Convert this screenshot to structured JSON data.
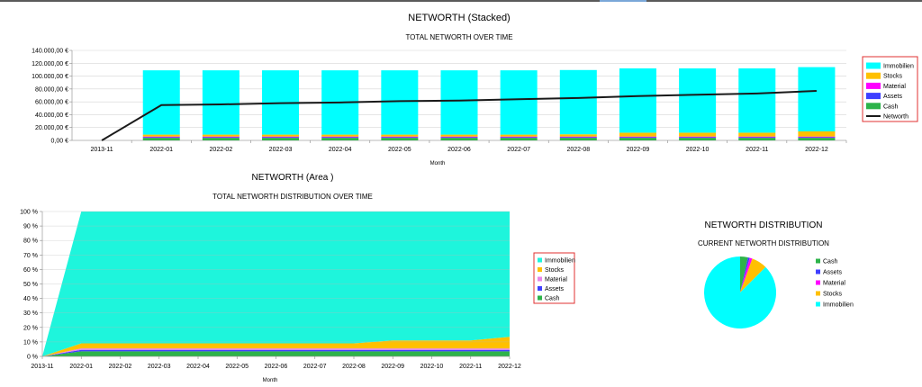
{
  "chart_data": [
    {
      "type": "bar",
      "title": "NETWORTH (Stacked)",
      "subtitle": "TOTAL NETWORTH OVER TIME",
      "xlabel": "Month",
      "ylabel": "",
      "ylim": [
        0,
        140000
      ],
      "yticks": [
        0,
        20000,
        40000,
        60000,
        80000,
        100000,
        120000,
        140000
      ],
      "ytick_labels": [
        "0,00 €",
        "20.000,00 €",
        "40.000,00 €",
        "60.000,00 €",
        "80.000,00 €",
        "100.000,00 €",
        "120.000,00 €",
        "140.000,00 €"
      ],
      "categories": [
        "2013-11",
        "2022-01",
        "2022-02",
        "2022-03",
        "2022-04",
        "2022-05",
        "2022-06",
        "2022-07",
        "2022-08",
        "2022-09",
        "2022-10",
        "2022-11",
        "2022-12"
      ],
      "series": [
        {
          "name": "Immobilien",
          "color": "#00ffff",
          "values": [
            0,
            100000,
            100000,
            100000,
            100000,
            100000,
            100000,
            100000,
            100000,
            100000,
            100000,
            100000,
            100000
          ]
        },
        {
          "name": "Stocks",
          "color": "#ffc000",
          "values": [
            0,
            3000,
            3000,
            3000,
            3000,
            3000,
            3000,
            3000,
            3500,
            6000,
            6000,
            6000,
            8000
          ]
        },
        {
          "name": "Material",
          "color": "#ff00ff",
          "values": [
            0,
            1000,
            1000,
            1000,
            1000,
            1000,
            1000,
            1000,
            1000,
            1000,
            1000,
            1000,
            1000
          ]
        },
        {
          "name": "Assets",
          "color": "#3f3fff",
          "values": [
            0,
            1000,
            1000,
            1000,
            1000,
            1000,
            1000,
            1000,
            1000,
            1000,
            1000,
            1000,
            1000
          ]
        },
        {
          "name": "Cash",
          "color": "#2db34a",
          "values": [
            0,
            4000,
            4000,
            4000,
            4000,
            4000,
            4000,
            4000,
            4000,
            4000,
            4000,
            4000,
            4000
          ]
        }
      ],
      "line": {
        "name": "Networth",
        "color": "#1a1a1a",
        "values": [
          0,
          55000,
          56000,
          58000,
          59000,
          61000,
          62000,
          64000,
          66000,
          69000,
          71000,
          73000,
          77000
        ]
      },
      "legend": {
        "placement": "right",
        "items": [
          "Immobilien",
          "Stocks",
          "Material",
          "Assets",
          "Cash",
          "Networth"
        ],
        "border_color": "#e03030"
      }
    },
    {
      "type": "area",
      "title": "NETWORTH (Area )",
      "subtitle": "TOTAL NETWORTH DISTRIBUTION OVER TIME",
      "xlabel": "Month",
      "ylabel": "",
      "ylim": [
        0,
        100
      ],
      "yticks": [
        0,
        10,
        20,
        30,
        40,
        50,
        60,
        70,
        80,
        90,
        100
      ],
      "ytick_labels": [
        "0 %",
        "10 %",
        "20 %",
        "30 %",
        "40 %",
        "50 %",
        "60 %",
        "70 %",
        "80 %",
        "90 %",
        "100 %"
      ],
      "categories": [
        "2013-11",
        "2022-01",
        "2022-02",
        "2022-03",
        "2022-04",
        "2022-05",
        "2022-06",
        "2022-07",
        "2022-08",
        "2022-09",
        "2022-10",
        "2022-11",
        "2022-12"
      ],
      "series": [
        {
          "name": "Cash",
          "color": "#2db34a",
          "values": [
            0,
            3.5,
            3.5,
            3.5,
            3.5,
            3.5,
            3.5,
            3.5,
            3.5,
            3.5,
            3.5,
            3.5,
            3.5
          ]
        },
        {
          "name": "Assets",
          "color": "#3f3fff",
          "values": [
            0,
            1,
            1,
            1,
            1,
            1,
            1,
            1,
            1,
            1,
            1,
            1,
            1
          ]
        },
        {
          "name": "Material",
          "color": "#e884e8",
          "values": [
            0,
            1,
            1,
            1,
            1,
            1,
            1,
            1,
            1,
            1,
            1,
            1,
            1
          ]
        },
        {
          "name": "Stocks",
          "color": "#ffc000",
          "values": [
            0,
            3.5,
            3.5,
            3.5,
            3.5,
            3.5,
            3.5,
            3.5,
            3.5,
            5.5,
            5.5,
            5.5,
            8
          ]
        },
        {
          "name": "Immobilien",
          "color": "#1ef5dc",
          "values": [
            0,
            91,
            91,
            91,
            91,
            91,
            91,
            91,
            91,
            89,
            89,
            89,
            86.5
          ]
        }
      ],
      "legend": {
        "placement": "right",
        "items": [
          "Immobilien",
          "Stocks",
          "Material",
          "Assets",
          "Cash"
        ],
        "border_color": "#e03030"
      }
    },
    {
      "type": "pie",
      "title": "NETWORTH DISTRIBUTION",
      "subtitle": "CURRENT NETWORTH DISTRIBUTION",
      "slices": [
        {
          "name": "Cash",
          "color": "#2db34a",
          "value": 3.5
        },
        {
          "name": "Assets",
          "color": "#3f3fff",
          "value": 0.8
        },
        {
          "name": "Material",
          "color": "#ff00ff",
          "value": 1.2
        },
        {
          "name": "Stocks",
          "color": "#ffc000",
          "value": 7
        },
        {
          "name": "Immobilien",
          "color": "#00ffff",
          "value": 87.5
        }
      ],
      "legend": {
        "placement": "right",
        "items": [
          "Cash",
          "Assets",
          "Material",
          "Stocks",
          "Immobilien"
        ]
      }
    }
  ]
}
